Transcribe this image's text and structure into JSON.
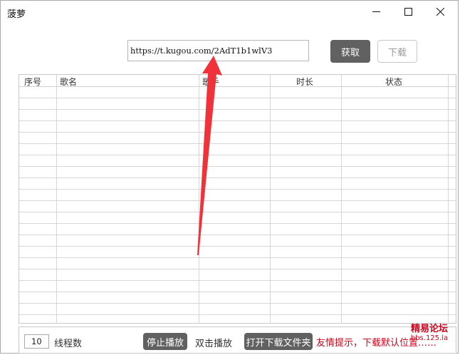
{
  "window": {
    "title": "菠萝"
  },
  "toolbar": {
    "url_value": "https://t.kugou.com/2AdT1b1wlV3",
    "fetch_label": "获取",
    "download_label": "下载"
  },
  "table": {
    "columns": [
      "序号",
      "歌名",
      "歌手",
      "时长",
      "状态"
    ],
    "rows": []
  },
  "bottom": {
    "threads_value": "10",
    "threads_label": "线程数",
    "stop_play_label": "停止播放",
    "double_click_label": "双击播放",
    "open_folder_label": "打开下载文件夹",
    "tip": "友情提示，下载默认位置……"
  },
  "watermark": {
    "line1": "精易论坛",
    "line2": "bbs.125.la"
  },
  "colors": {
    "dark_button": "#616161",
    "tip_red": "#d0021b",
    "arrow_red": "#f0333b"
  },
  "icons": {
    "minimize": "minimize-icon",
    "maximize": "maximize-icon",
    "close": "close-icon"
  }
}
